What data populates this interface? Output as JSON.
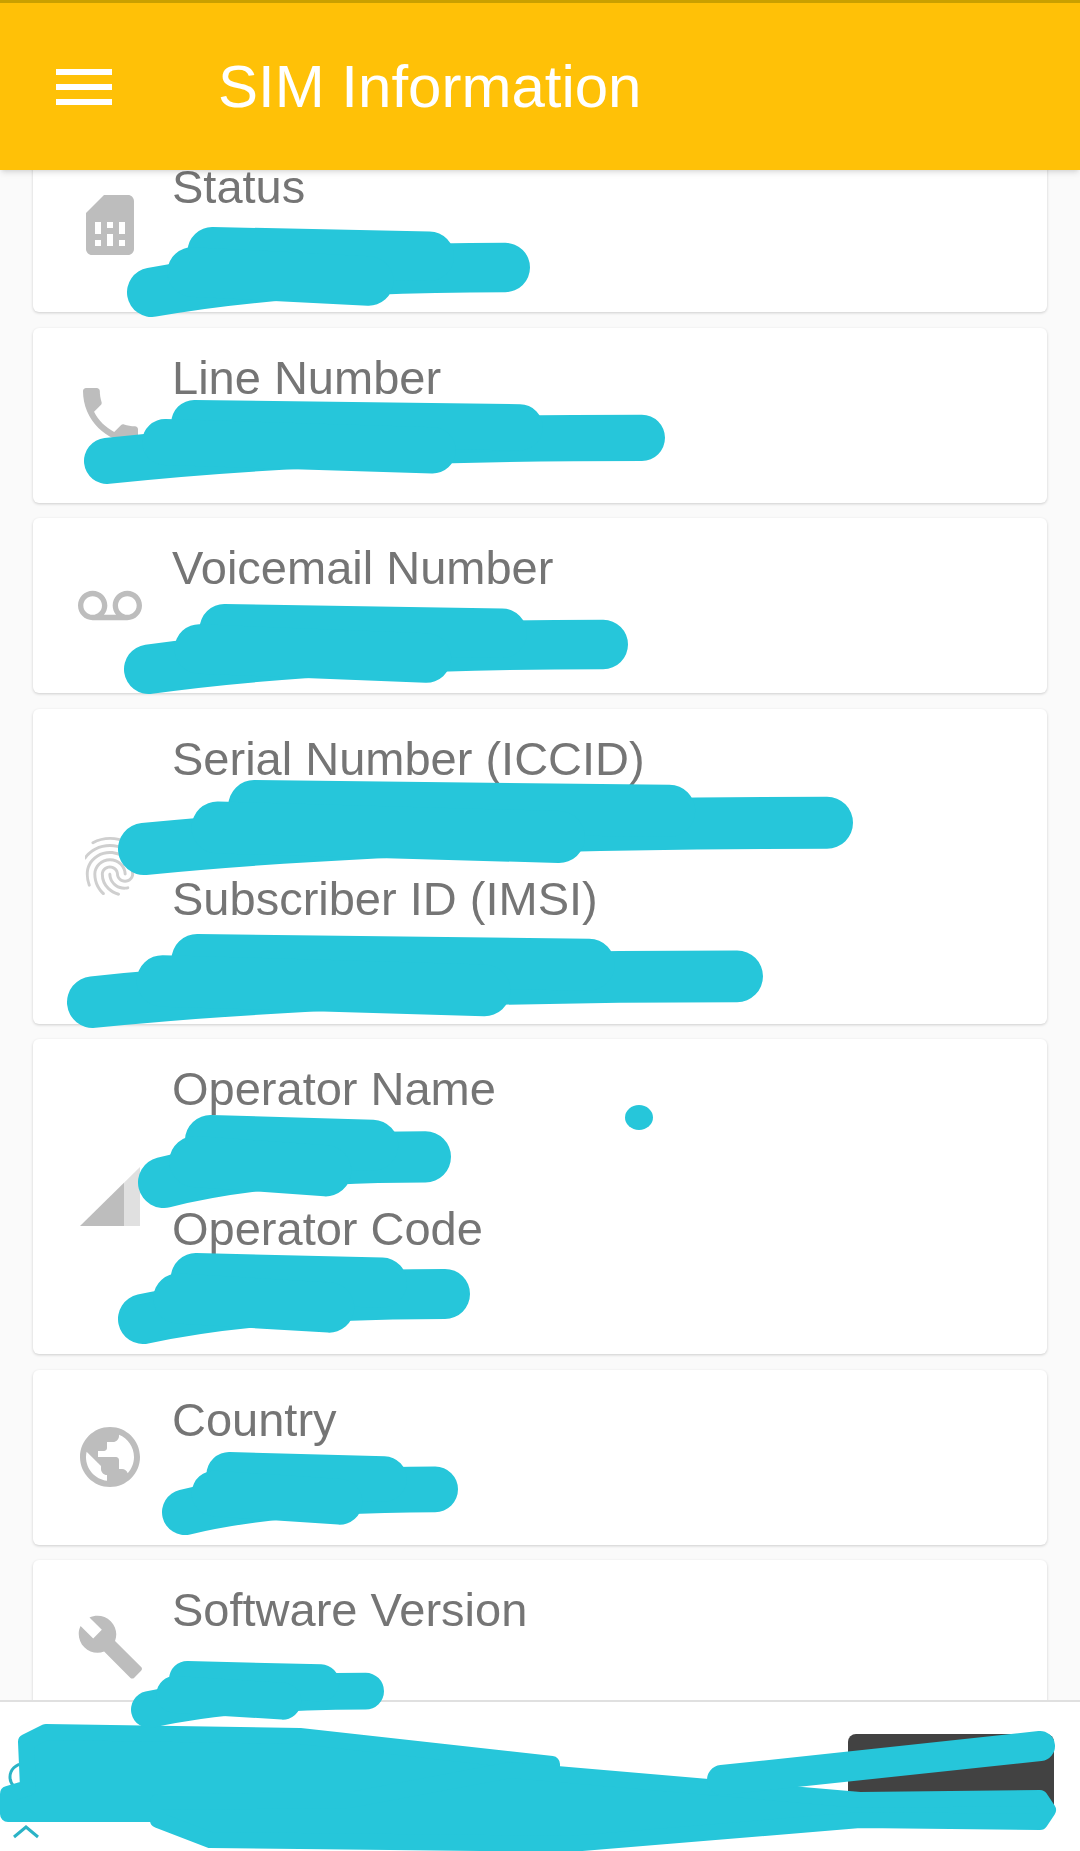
{
  "app_bar": {
    "title": "SIM Information"
  },
  "cards": [
    {
      "fields": [
        {
          "label": "Status",
          "redacted": true
        }
      ]
    },
    {
      "fields": [
        {
          "label": "Line Number",
          "redacted": true
        }
      ]
    },
    {
      "fields": [
        {
          "label": "Voicemail Number",
          "redacted": true
        }
      ]
    },
    {
      "fields": [
        {
          "label": "Serial Number (ICCID)",
          "redacted": true
        },
        {
          "label": "Subscriber ID (IMSI)",
          "redacted": true
        }
      ]
    },
    {
      "fields": [
        {
          "label": "Operator Name",
          "redacted": true
        },
        {
          "label": "Operator Code",
          "redacted": true
        }
      ]
    },
    {
      "fields": [
        {
          "label": "Country",
          "redacted": true
        }
      ]
    },
    {
      "fields": [
        {
          "label": "Software Version",
          "redacted": true
        }
      ]
    }
  ],
  "ad_banner": {
    "redacted": true
  }
}
